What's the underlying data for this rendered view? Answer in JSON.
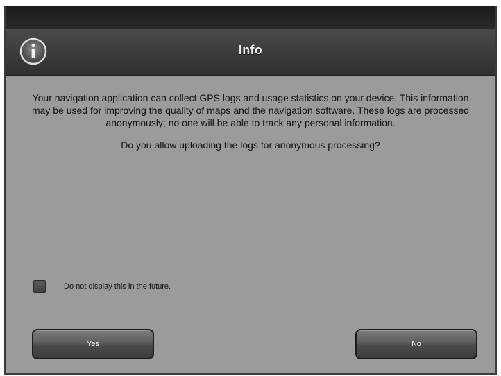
{
  "dialog": {
    "title": "Info",
    "icon": "info-icon",
    "message": "Your navigation application can collect GPS logs and usage statistics on your device. This information may be used for improving the quality of maps and the navigation software. These logs are processed anonymously; no one will be able to track any personal information.",
    "question": "Do you allow uploading the logs for anonymous processing?",
    "checkbox_label": "Do not display this in the future.",
    "checkbox_checked": false,
    "yes_label": "Yes",
    "no_label": "No"
  },
  "colors": {
    "background": "#9b9b9b",
    "titlebar": "#3a3a3a",
    "button": "#555555"
  }
}
